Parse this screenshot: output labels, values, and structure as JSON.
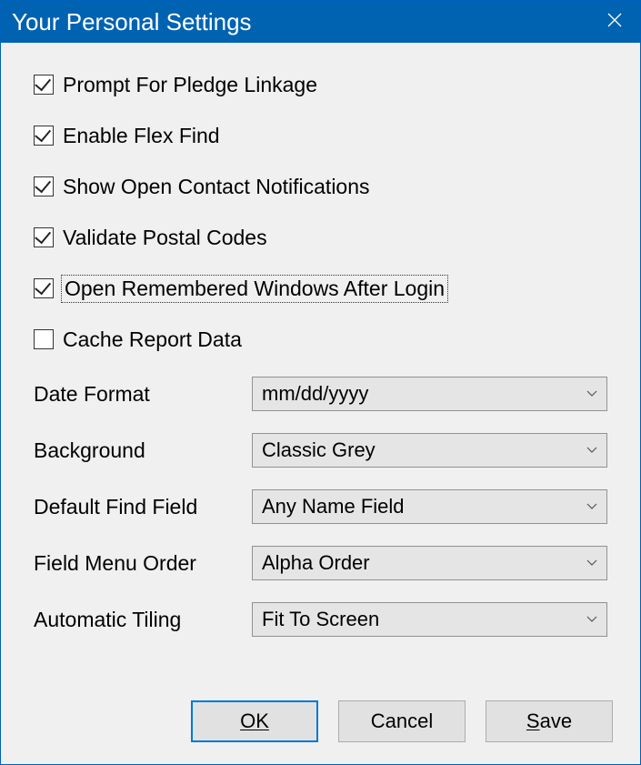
{
  "window": {
    "title": "Your Personal Settings"
  },
  "checkboxes": [
    {
      "label": "Prompt For Pledge Linkage",
      "checked": true,
      "focused": false
    },
    {
      "label": "Enable Flex Find",
      "checked": true,
      "focused": false
    },
    {
      "label": "Show Open Contact Notifications",
      "checked": true,
      "focused": false
    },
    {
      "label": "Validate Postal Codes",
      "checked": true,
      "focused": false
    },
    {
      "label": "Open Remembered Windows After Login",
      "checked": true,
      "focused": true
    },
    {
      "label": "Cache Report Data",
      "checked": false,
      "focused": false
    }
  ],
  "fields": [
    {
      "label": "Date Format",
      "value": "mm/dd/yyyy"
    },
    {
      "label": "Background",
      "value": "Classic Grey"
    },
    {
      "label": "Default Find Field",
      "value": "Any Name Field"
    },
    {
      "label": "Field Menu Order",
      "value": "Alpha Order"
    },
    {
      "label": "Automatic Tiling",
      "value": "Fit To Screen"
    }
  ],
  "buttons": {
    "ok": "OK",
    "cancel": "Cancel",
    "save": "Save"
  }
}
